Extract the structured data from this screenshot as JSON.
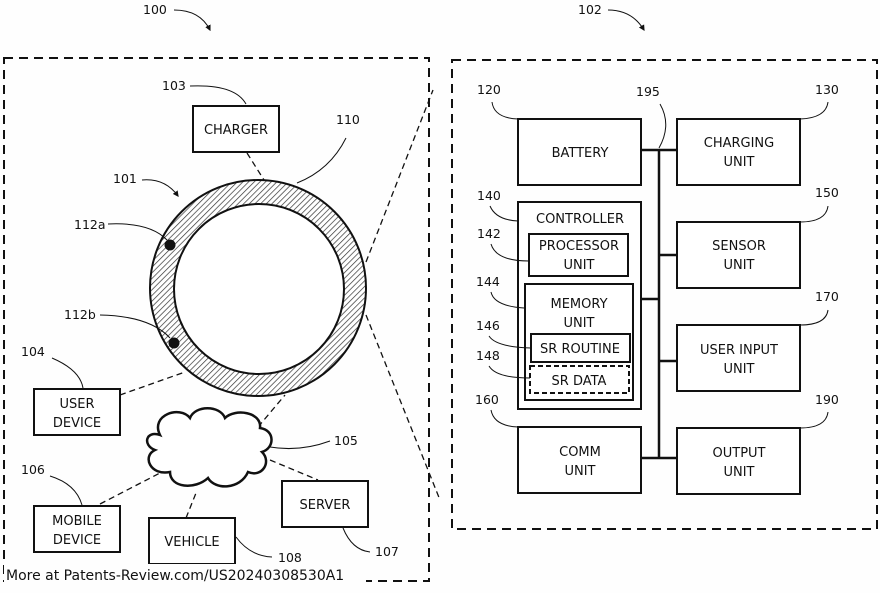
{
  "figure": {
    "system_ref": "100",
    "device_ref": "102",
    "footer": "More at Patents-Review.com/US20240308530A1"
  },
  "left_panel": {
    "ring": {
      "ref": "101",
      "band_ref": "110",
      "sensor_a_ref": "112a",
      "sensor_b_ref": "112b"
    },
    "network": {
      "ref": "105"
    },
    "charger": {
      "ref": "103",
      "label": "CHARGER"
    },
    "user_device": {
      "ref": "104",
      "line1": "USER",
      "line2": "DEVICE"
    },
    "mobile_device": {
      "ref": "106",
      "line1": "MOBILE",
      "line2": "DEVICE"
    },
    "vehicle": {
      "ref": "108",
      "label": "VEHICLE"
    },
    "server": {
      "ref": "107",
      "label": "SERVER"
    }
  },
  "right_panel": {
    "bus_ref": "195",
    "battery": {
      "ref": "120",
      "label": "BATTERY"
    },
    "charging_unit": {
      "ref": "130",
      "line1": "CHARGING",
      "line2": "UNIT"
    },
    "controller": {
      "ref": "140",
      "label": "CONTROLLER"
    },
    "processor_unit": {
      "ref": "142",
      "line1": "PROCESSOR",
      "line2": "UNIT"
    },
    "memory_unit": {
      "ref": "144",
      "line1": "MEMORY",
      "line2": "UNIT"
    },
    "sr_routine": {
      "ref": "146",
      "label": "SR ROUTINE"
    },
    "sr_data": {
      "ref": "148",
      "label": "SR DATA"
    },
    "sensor_unit": {
      "ref": "150",
      "line1": "SENSOR",
      "line2": "UNIT"
    },
    "comm_unit": {
      "ref": "160",
      "line1": "COMM",
      "line2": "UNIT"
    },
    "user_input_unit": {
      "ref": "170",
      "line1": "USER INPUT",
      "line2": "UNIT"
    },
    "output_unit": {
      "ref": "190",
      "line1": "OUTPUT",
      "line2": "UNIT"
    }
  }
}
